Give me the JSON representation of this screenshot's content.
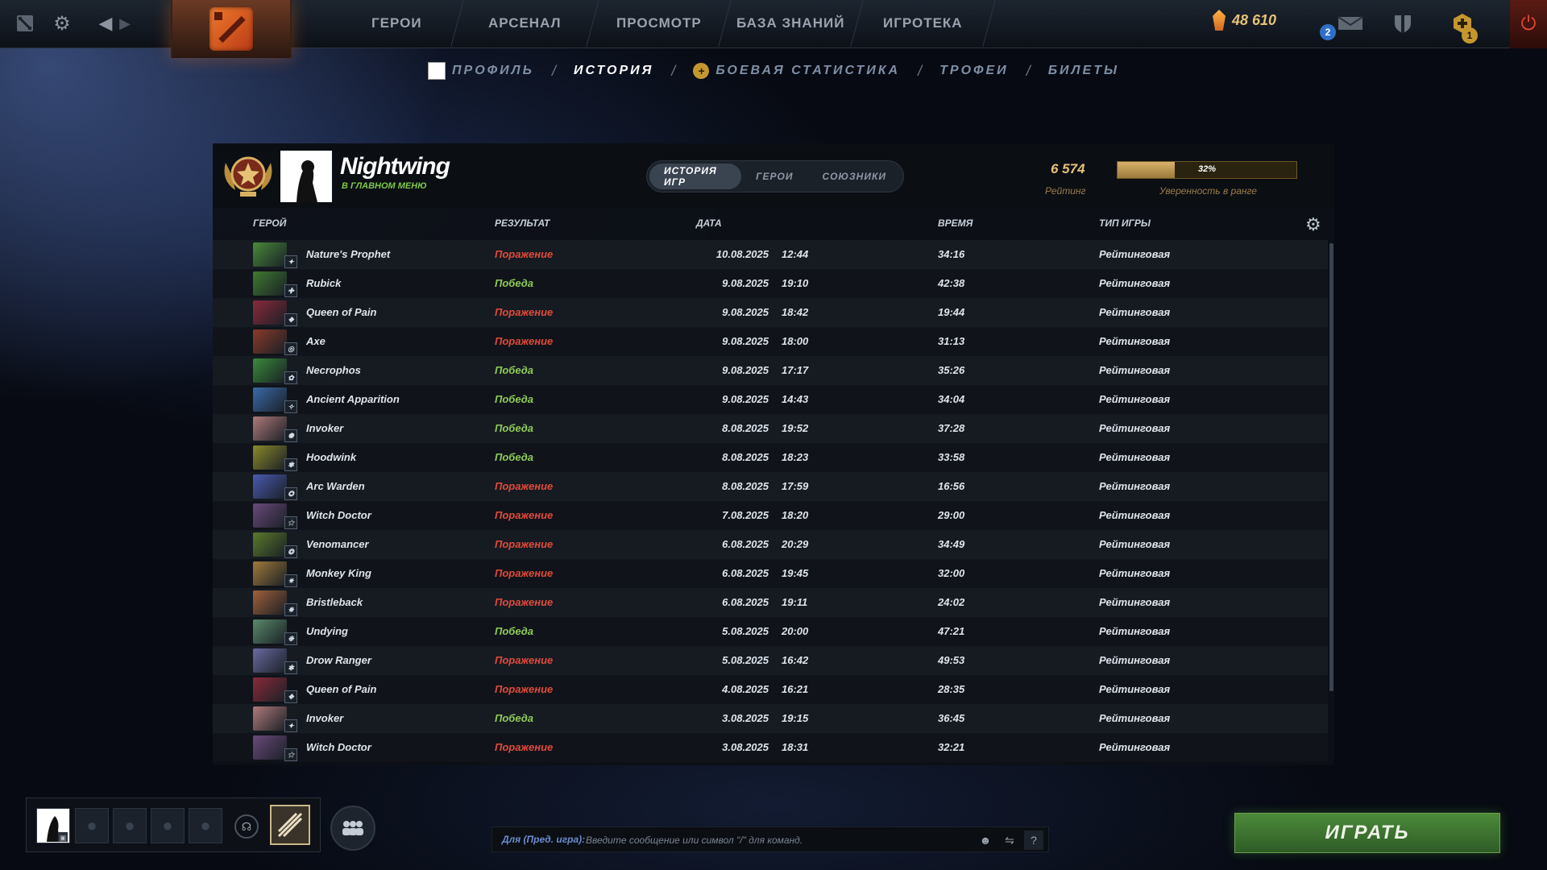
{
  "topbar": {
    "nav": [
      "ГЕРОИ",
      "АРСЕНАЛ",
      "ПРОСМОТР",
      "БАЗА ЗНАНИЙ",
      "ИГРОТЕКА"
    ],
    "shards": "48 610",
    "mail_count": "2",
    "notif_count": "1"
  },
  "subnav": {
    "items": [
      "ПРОФИЛЬ",
      "ИСТОРИЯ",
      "БОЕВАЯ СТАТИСТИКА",
      "ТРОФЕИ",
      "БИЛЕТЫ"
    ],
    "active": "ИСТОРИЯ"
  },
  "profile": {
    "name": "Nightwing",
    "status": "В ГЛАВНОМ МЕНЮ",
    "tabs": [
      "ИСТОРИЯ ИГР",
      "ГЕРОИ",
      "СОЮЗНИКИ"
    ],
    "rating": "6 574",
    "rating_label": "Рейтинг",
    "confidence": "32%",
    "confidence_value": 0.32,
    "confidence_label": "Уверенность в ранге"
  },
  "columns": {
    "hero": "ГЕРОЙ",
    "result": "РЕЗУЛЬТАТ",
    "date": "ДАТА",
    "time": "ВРЕМЯ",
    "type": "ТИП ИГРЫ"
  },
  "matches": [
    {
      "hero": "Nature's Prophet",
      "result": "Поражение",
      "win": false,
      "date": "10.08.2025",
      "clock": "12:44",
      "duration": "34:16",
      "type": "Рейтинговая",
      "color": "#4a8a3a"
    },
    {
      "hero": "Rubick",
      "result": "Победа",
      "win": true,
      "date": "9.08.2025",
      "clock": "19:10",
      "duration": "42:38",
      "type": "Рейтинговая",
      "color": "#3f7a2f"
    },
    {
      "hero": "Queen of Pain",
      "result": "Поражение",
      "win": false,
      "date": "9.08.2025",
      "clock": "18:42",
      "duration": "19:44",
      "type": "Рейтинговая",
      "color": "#8a2a3a"
    },
    {
      "hero": "Axe",
      "result": "Поражение",
      "win": false,
      "date": "9.08.2025",
      "clock": "18:00",
      "duration": "31:13",
      "type": "Рейтинговая",
      "color": "#8a3a2a"
    },
    {
      "hero": "Necrophos",
      "result": "Победа",
      "win": true,
      "date": "9.08.2025",
      "clock": "17:17",
      "duration": "35:26",
      "type": "Рейтинговая",
      "color": "#3a8a3a"
    },
    {
      "hero": "Ancient Apparition",
      "result": "Победа",
      "win": true,
      "date": "9.08.2025",
      "clock": "14:43",
      "duration": "34:04",
      "type": "Рейтинговая",
      "color": "#3a6aa8"
    },
    {
      "hero": "Invoker",
      "result": "Победа",
      "win": true,
      "date": "8.08.2025",
      "clock": "19:52",
      "duration": "37:28",
      "type": "Рейтинговая",
      "color": "#b07a7a"
    },
    {
      "hero": "Hoodwink",
      "result": "Победа",
      "win": true,
      "date": "8.08.2025",
      "clock": "18:23",
      "duration": "33:58",
      "type": "Рейтинговая",
      "color": "#8a8a2a"
    },
    {
      "hero": "Arc Warden",
      "result": "Поражение",
      "win": false,
      "date": "8.08.2025",
      "clock": "17:59",
      "duration": "16:56",
      "type": "Рейтинговая",
      "color": "#4a5ab0"
    },
    {
      "hero": "Witch Doctor",
      "result": "Поражение",
      "win": false,
      "date": "7.08.2025",
      "clock": "18:20",
      "duration": "29:00",
      "type": "Рейтинговая",
      "color": "#6a4a7a"
    },
    {
      "hero": "Venomancer",
      "result": "Поражение",
      "win": false,
      "date": "6.08.2025",
      "clock": "20:29",
      "duration": "34:49",
      "type": "Рейтинговая",
      "color": "#5a7a2a"
    },
    {
      "hero": "Monkey King",
      "result": "Поражение",
      "win": false,
      "date": "6.08.2025",
      "clock": "19:45",
      "duration": "32:00",
      "type": "Рейтинговая",
      "color": "#a07a3a"
    },
    {
      "hero": "Bristleback",
      "result": "Поражение",
      "win": false,
      "date": "6.08.2025",
      "clock": "19:11",
      "duration": "24:02",
      "type": "Рейтинговая",
      "color": "#a0603a"
    },
    {
      "hero": "Undying",
      "result": "Победа",
      "win": true,
      "date": "5.08.2025",
      "clock": "20:00",
      "duration": "47:21",
      "type": "Рейтинговая",
      "color": "#5a8a6a"
    },
    {
      "hero": "Drow Ranger",
      "result": "Поражение",
      "win": false,
      "date": "5.08.2025",
      "clock": "16:42",
      "duration": "49:53",
      "type": "Рейтинговая",
      "color": "#6a6aa0"
    },
    {
      "hero": "Queen of Pain",
      "result": "Поражение",
      "win": false,
      "date": "4.08.2025",
      "clock": "16:21",
      "duration": "28:35",
      "type": "Рейтинговая",
      "color": "#8a2a3a"
    },
    {
      "hero": "Invoker",
      "result": "Победа",
      "win": true,
      "date": "3.08.2025",
      "clock": "19:15",
      "duration": "36:45",
      "type": "Рейтинговая",
      "color": "#b07a7a"
    },
    {
      "hero": "Witch Doctor",
      "result": "Поражение",
      "win": false,
      "date": "3.08.2025",
      "clock": "18:31",
      "duration": "32:21",
      "type": "Рейтинговая",
      "color": "#6a4a7a"
    }
  ],
  "chat": {
    "label": "Для (Пред. игра):",
    "placeholder": "Введите сообщение или символ \"/\" для команд."
  },
  "play_label": "ИГРАТЬ",
  "colors": {
    "win": "#8fcb56",
    "loss": "#e24a3b",
    "gold": "#e6c277",
    "play": "#3f7a31"
  }
}
